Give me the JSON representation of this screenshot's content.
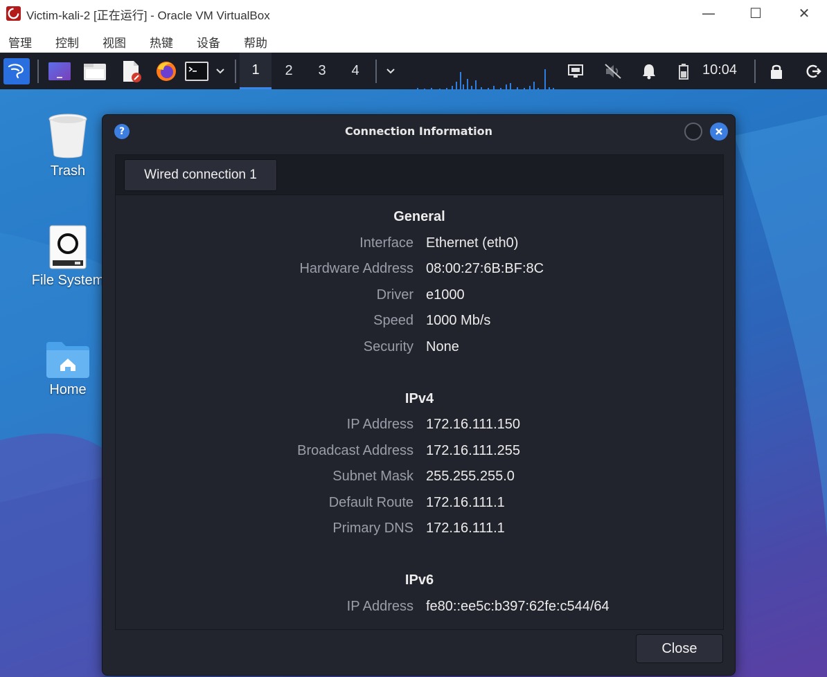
{
  "window": {
    "title": "Victim-kali-2 [正在运行] - Oracle VM VirtualBox",
    "minimize_glyph": "—",
    "maximize_glyph": "☐",
    "close_glyph": "✕"
  },
  "menubar": {
    "items": [
      "管理",
      "控制",
      "视图",
      "热键",
      "设备",
      "帮助"
    ]
  },
  "panel": {
    "workspaces": [
      "1",
      "2",
      "3",
      "4"
    ],
    "clock": "10:04",
    "launchers": [
      "kali-menu-icon",
      "desktop-icon",
      "file-manager-icon",
      "text-editor-icon",
      "firefox-icon",
      "terminal-icon"
    ],
    "tray": [
      "network-icon",
      "volume-muted-icon",
      "notification-bell-icon",
      "battery-icon",
      "lock-icon",
      "logout-icon"
    ]
  },
  "desktop": {
    "icons": [
      {
        "label": "Trash",
        "icon": "trash-icon"
      },
      {
        "label": "File System",
        "icon": "drive-icon"
      },
      {
        "label": "Home",
        "icon": "home-folder-icon"
      }
    ]
  },
  "dialog": {
    "title": "Connection Information",
    "tab_label": "Wired connection 1",
    "close_label": "Close",
    "general": {
      "heading": "General",
      "rows": [
        {
          "key": "Interface",
          "value": "Ethernet (eth0)"
        },
        {
          "key": "Hardware Address",
          "value": "08:00:27:6B:BF:8C"
        },
        {
          "key": "Driver",
          "value": "e1000"
        },
        {
          "key": "Speed",
          "value": "1000 Mb/s"
        },
        {
          "key": "Security",
          "value": "None"
        }
      ]
    },
    "ipv4": {
      "heading": "IPv4",
      "rows": [
        {
          "key": "IP Address",
          "value": "172.16.111.150"
        },
        {
          "key": "Broadcast Address",
          "value": "172.16.111.255"
        },
        {
          "key": "Subnet Mask",
          "value": "255.255.255.0"
        },
        {
          "key": "Default Route",
          "value": "172.16.111.1"
        },
        {
          "key": "Primary DNS",
          "value": "172.16.111.1"
        }
      ]
    },
    "ipv6": {
      "heading": "IPv6",
      "rows": [
        {
          "key": "IP Address",
          "value": "fe80::ee5c:b397:62fe:c544/64"
        }
      ]
    }
  },
  "colors": {
    "accent": "#3d7fe0",
    "panel_bg": "#1b1e26",
    "dialog_bg": "#23252e"
  }
}
